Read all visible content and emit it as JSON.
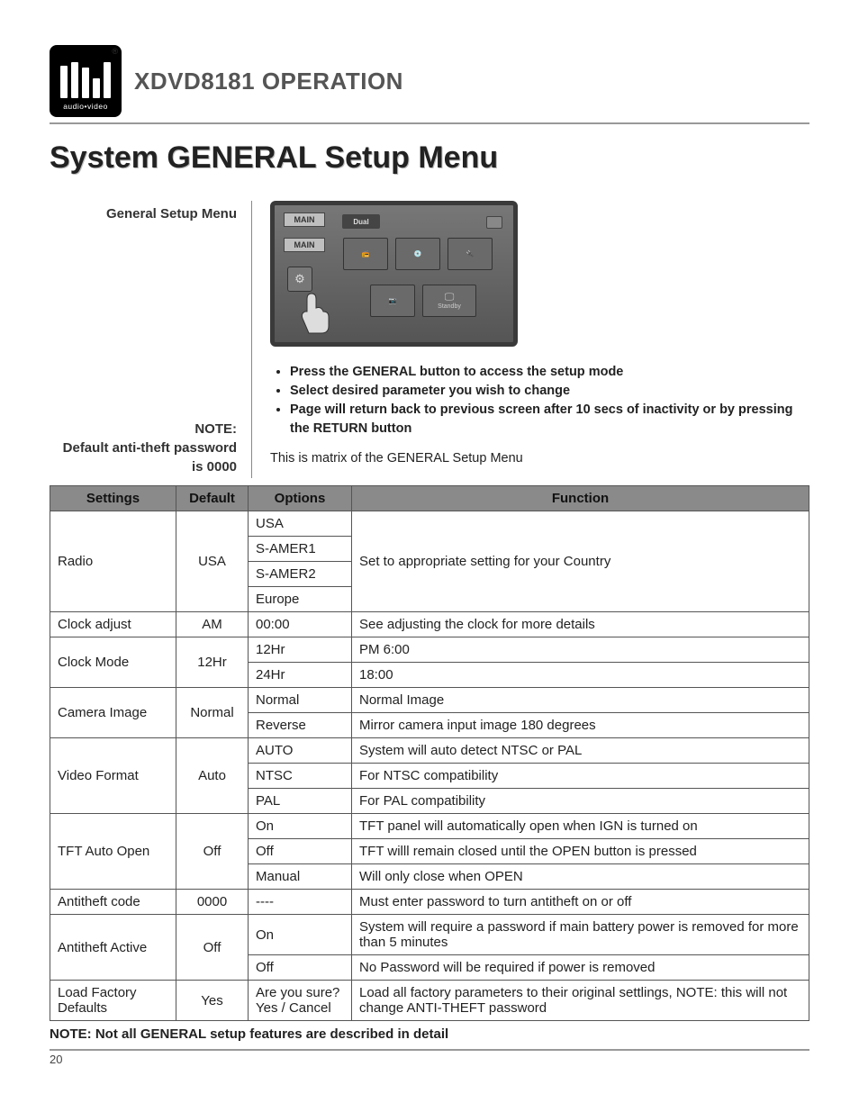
{
  "logo": {
    "subtext": "audio•video",
    "reg": "®"
  },
  "header": {
    "model": "XDVD8181",
    "section": "OPERATION"
  },
  "page_title": "System GENERAL Setup Menu",
  "intro": {
    "left_heading": "General Setup Menu",
    "note_label": "NOTE:",
    "note_text_1": "Default anti-theft password",
    "note_text_2": "is 0000",
    "instructions": [
      "Press the GENERAL button to access the setup mode",
      "Select desired parameter you wish to change",
      "Page will return back to previous screen after 10 secs of inactivity or by pressing the RETURN button"
    ],
    "matrix_intro": "This is matrix of the GENERAL Setup Menu"
  },
  "device": {
    "main1": "MAIN",
    "main2": "MAIN",
    "dual": "Dual",
    "standby": "Standby"
  },
  "table": {
    "headers": {
      "settings": "Settings",
      "default": "Default",
      "options": "Options",
      "function": "Function"
    },
    "rows": [
      {
        "setting": "Radio",
        "default": "USA",
        "options": [
          "USA",
          "S-AMER1",
          "S-AMER2",
          "Europe"
        ],
        "functions": [
          "Set to appropriate setting for your Country"
        ]
      },
      {
        "setting": "Clock adjust",
        "default": "AM",
        "options": [
          "00:00"
        ],
        "functions": [
          "See adjusting the clock for more details"
        ]
      },
      {
        "setting": "Clock Mode",
        "default": "12Hr",
        "options": [
          "12Hr",
          "24Hr"
        ],
        "functions": [
          "PM 6:00",
          "18:00"
        ]
      },
      {
        "setting": "Camera Image",
        "default": "Normal",
        "options": [
          "Normal",
          "Reverse"
        ],
        "functions": [
          "Normal Image",
          "Mirror camera input image 180 degrees"
        ]
      },
      {
        "setting": "Video Format",
        "default": "Auto",
        "options": [
          "AUTO",
          "NTSC",
          "PAL"
        ],
        "functions": [
          "System will auto detect NTSC or PAL",
          "For NTSC compatibility",
          "For PAL compatibility"
        ]
      },
      {
        "setting": "TFT Auto Open",
        "default": "Off",
        "options": [
          "On",
          "Off",
          "Manual"
        ],
        "functions": [
          "TFT panel will automatically open when IGN is turned on",
          "TFT willl remain closed until the OPEN button is pressed",
          "Will only close when OPEN"
        ]
      },
      {
        "setting": "Antitheft code",
        "default": "0000",
        "options": [
          "----"
        ],
        "functions": [
          "Must enter password to turn antitheft on or off"
        ]
      },
      {
        "setting": "Antitheft Active",
        "default": "Off",
        "options": [
          "On",
          "Off"
        ],
        "functions": [
          "System will require a password if main battery power is removed for more than 5 minutes",
          "No Password will be required if power is removed"
        ]
      },
      {
        "setting": "Load Factory Defaults",
        "default": "Yes",
        "options": [
          "Are you sure? Yes / Cancel"
        ],
        "functions": [
          "Load all factory parameters to their original settlings, NOTE: this will not change ANTI-THEFT password"
        ]
      }
    ]
  },
  "footnote": "NOTE: Not all GENERAL setup features are described in detail",
  "page_number": "20"
}
